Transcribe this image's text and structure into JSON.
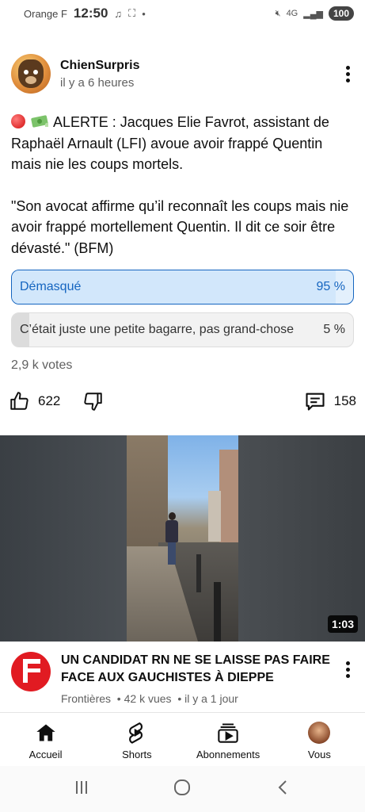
{
  "status_bar": {
    "carrier": "Orange F",
    "time": "12:50",
    "network": "4G",
    "battery": "100"
  },
  "post": {
    "author": "ChienSurpris",
    "time_ago": "il y a 6 heures",
    "text_line1": "ALERTE : Jacques Elie Favrot, assistant de Raphaël Arnault (LFI) avoue avoir frappé Quentin mais nie les coups mortels.",
    "text_line2": "\"Son avocat affirme qu’il reconnaît les coups mais nie avoir frappé mortellement Quentin. Il dit ce soir être dévasté.\" (BFM)",
    "poll": {
      "options": [
        {
          "label": "Démasqué",
          "percent": "95 %",
          "value": 95,
          "selected": true
        },
        {
          "label": "C’était juste une petite bagarre, pas grand-chose",
          "percent": "5 %",
          "value": 5,
          "selected": false
        }
      ],
      "votes": "2,9 k votes"
    },
    "likes": "622",
    "comments": "158"
  },
  "video": {
    "duration": "1:03",
    "title": "UN CANDIDAT RN NE SE LAISSE PAS FAIRE FACE AUX GAUCHISTES À DIEPPE",
    "channel": "Frontières",
    "views": "42 k vues",
    "age": "il y a 1 jour"
  },
  "bottom_nav": {
    "home": "Accueil",
    "shorts": "Shorts",
    "subscriptions": "Abonnements",
    "you": "Vous"
  },
  "colors": {
    "accent_blue": "#1565c0",
    "poll_selected_bg": "#e3f0fc",
    "brand_red": "#e11b22"
  }
}
